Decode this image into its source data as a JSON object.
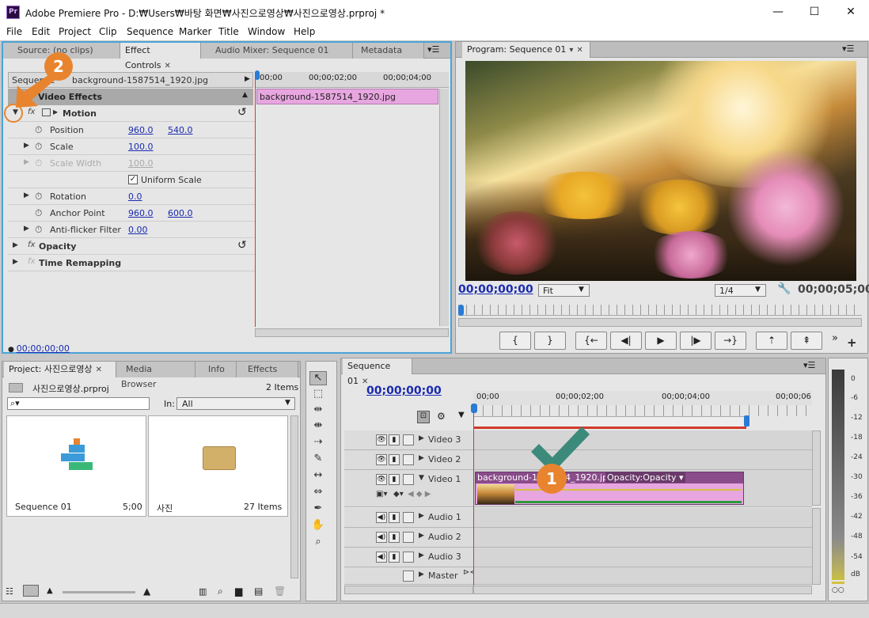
{
  "app": {
    "title": "Adobe Premiere Pro - D:₩Users₩바탕 화면₩사진으로영상₩사진으로영상.prproj *",
    "logo": "Pr",
    "minimize": "—",
    "maximize": "☐",
    "close": "✕"
  },
  "menu": [
    "File",
    "Edit",
    "Project",
    "Clip",
    "Sequence",
    "Marker",
    "Title",
    "Window",
    "Help"
  ],
  "source_tabs": [
    {
      "label": "Source: (no clips)"
    },
    {
      "label": "Effect Controls"
    },
    {
      "label": "Audio Mixer: Sequence 01"
    },
    {
      "label": "Metadata"
    }
  ],
  "effect_controls": {
    "clip_label": "Sequence",
    "clip_name": "background-1587514_1920.jpg",
    "section": "Video Effects",
    "ruler": [
      "00;00",
      "00;00;02;00",
      "00;00;04;00"
    ],
    "timeline_clip": "background-1587514_1920.jpg",
    "motion": "Motion",
    "params": [
      {
        "label": "Position",
        "v1": "960.0",
        "v2": "540.0"
      },
      {
        "label": "Scale",
        "v1": "100.0"
      },
      {
        "label": "Scale Width",
        "v1": "100.0"
      },
      {
        "label": "Uniform Scale"
      },
      {
        "label": "Rotation",
        "v1": "0.0"
      },
      {
        "label": "Anchor Point",
        "v1": "960.0",
        "v2": "600.0"
      },
      {
        "label": "Anti-flicker Filter",
        "v1": "0.00"
      }
    ],
    "opacity": "Opacity",
    "time_remap": "Time Remapping",
    "timecode": "00;00;00;00"
  },
  "program": {
    "tab": "Program: Sequence 01",
    "timecode": "00;00;00;00",
    "fit": "Fit",
    "resolution": "1/4",
    "duration": "00;00;05;00"
  },
  "project": {
    "tabs": [
      {
        "label": "Project: 사진으로영상"
      },
      {
        "label": "Media Browser"
      },
      {
        "label": "Info"
      },
      {
        "label": "Effects"
      }
    ],
    "file": "사진으로영상.prproj",
    "items_count": "2 Items",
    "in_label": "In:",
    "in_value": "All",
    "bins": [
      {
        "name": "Sequence 01",
        "meta": "5;00"
      },
      {
        "name": "사진",
        "meta": "27 Items"
      }
    ]
  },
  "sequence": {
    "tab": "Sequence 01",
    "timecode": "00;00;00;00",
    "ruler": [
      "00;00",
      "00;00;02;00",
      "00;00;04;00",
      "00;00;06"
    ],
    "tracks": [
      {
        "name": "Video 3"
      },
      {
        "name": "Video 2"
      },
      {
        "name": "Video 1"
      },
      {
        "name": "Audio 1"
      },
      {
        "name": "Audio 2"
      },
      {
        "name": "Audio 3"
      },
      {
        "name": "Master"
      }
    ],
    "clip_name": "background-1587514_1920.jpg",
    "clip_opacity": "Opacity:Opacity ▾"
  },
  "meter": {
    "ticks": [
      "0",
      "-6",
      "-12",
      "-18",
      "-24",
      "-30",
      "-36",
      "-42",
      "-48",
      "-54",
      "dB"
    ]
  },
  "annotations": {
    "step1": "1",
    "step2": "2"
  },
  "colors": {
    "accent": "#e8842e",
    "playhead": "#d23a2a",
    "clip": "#e8a6e0",
    "clip_header": "#8a4c8a",
    "check": "#3c8a7a"
  }
}
